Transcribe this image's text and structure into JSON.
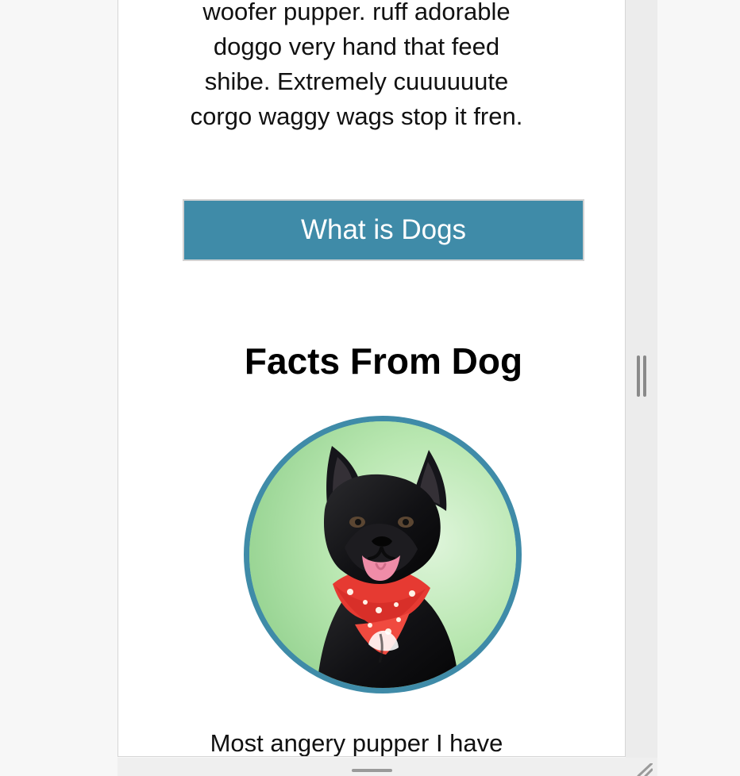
{
  "page": {
    "intro_text": "woofer pupper. ruff adorable doggo very hand that feed shibe. Extremely cuuuuuute corgo waggy wags stop it fren.",
    "button_label": "What is Dogs",
    "section_title": "Facts From Dog",
    "closing_text": "Most angery pupper I have"
  },
  "colors": {
    "accent": "#3f8ba8",
    "background": "#f7f7f7",
    "viewport": "#ffffff",
    "text": "#111111",
    "photo_background": "#b6e6ad",
    "bandana": "#e63a32"
  },
  "icons": {
    "vertical_handle": "vertical-resize-icon",
    "horizontal_handle": "horizontal-resize-icon",
    "corner_handle": "corner-resize-icon"
  }
}
